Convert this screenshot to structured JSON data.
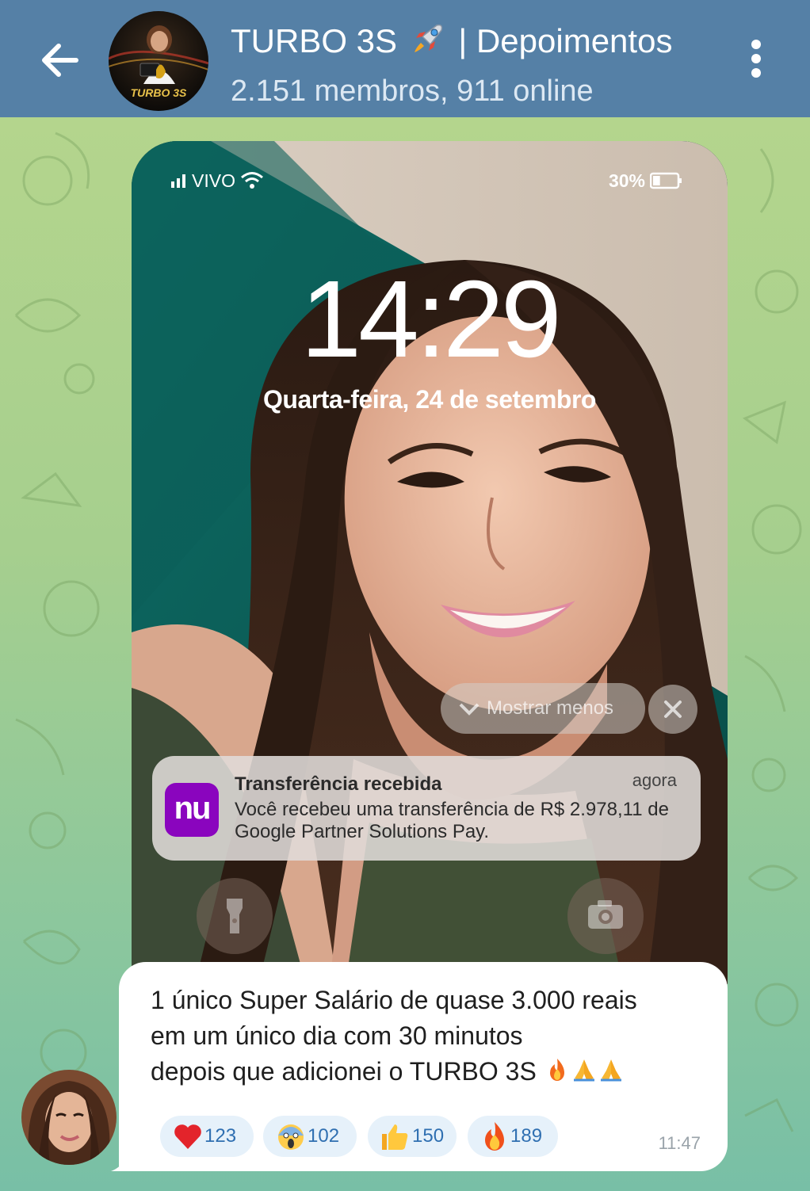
{
  "header": {
    "title_left": "TURBO 3S",
    "title_right": "| Depoimentos",
    "subtitle": "2.151 membros, 911 online",
    "avatar_text": "TURBO 3S"
  },
  "icons": {
    "back": "arrow-left-icon",
    "menu": "more-vertical-icon",
    "title_emoji": "rocket-icon"
  },
  "lockscreen": {
    "carrier": "VIVO",
    "battery": "30%",
    "battery_level": 0.3,
    "time": "14:29",
    "date": "Quarta-feira, 24 de setembro",
    "show_less": "Mostrar menos",
    "notification": {
      "app_logo": "nu",
      "title": "Transferência recebida",
      "time": "agora",
      "body": "Você recebeu uma transferência de R$ 2.978,11 de Google Partner Solutions Pay."
    }
  },
  "message": {
    "line1": "1 único Super Salário de quase 3.000 reais",
    "line2": "em um único dia com 30 minutos",
    "line3": "depois que adicionei o TURBO 3S",
    "time": "11:47",
    "reactions": [
      {
        "emoji": "heart",
        "count": "123"
      },
      {
        "emoji": "screaming-face",
        "count": "102"
      },
      {
        "emoji": "thumbs-up",
        "count": "150"
      },
      {
        "emoji": "fire",
        "count": "189"
      }
    ]
  },
  "colors": {
    "header_bg": "#5580a6",
    "nubank_purple": "#8a05be",
    "reaction_bg": "#e6f1fa",
    "reaction_text": "#2f6fb1"
  }
}
